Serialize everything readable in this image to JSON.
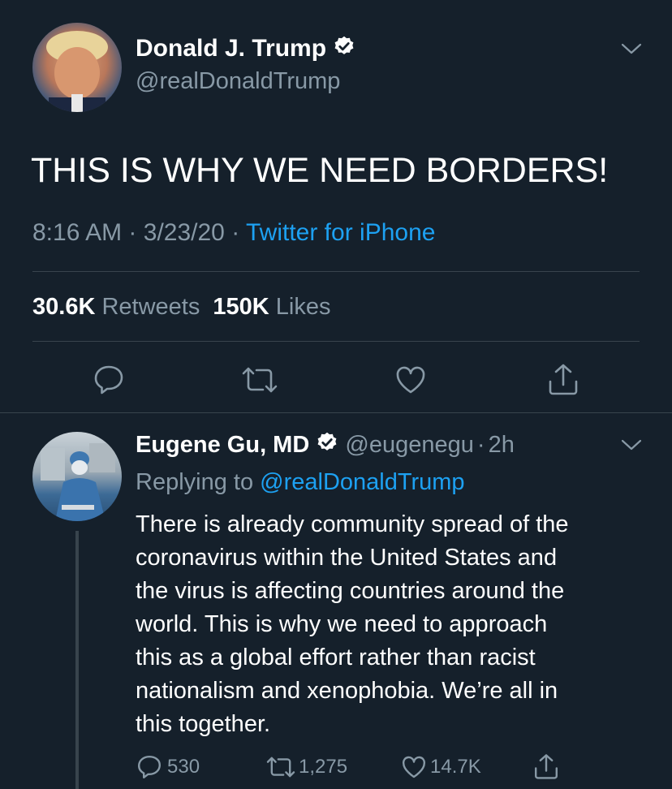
{
  "main_tweet": {
    "author_name": "Donald J. Trump",
    "handle": "@realDonaldTrump",
    "text": "THIS IS WHY WE NEED BORDERS!",
    "time": "8:16 AM",
    "separator": "·",
    "date": "3/23/20",
    "source": "Twitter for iPhone",
    "retweets_count": "30.6K",
    "retweets_label": "Retweets",
    "likes_count": "150K",
    "likes_label": "Likes"
  },
  "reply": {
    "author_name": "Eugene Gu, MD",
    "handle": "@eugenegu",
    "separator": "·",
    "age": "2h",
    "replying_prefix": "Replying to",
    "replying_to": "@realDonaldTrump",
    "text_lines": [
      "There is already community spread of the",
      "coronavirus within the United States and",
      "the virus is affecting countries around the",
      "world. This is why we need to approach",
      "this as a global effort rather than racist",
      "nationalism and xenophobia. We’re all in",
      "this together."
    ],
    "reply_count": "530",
    "retweet_count": "1,275",
    "like_count": "14.7K"
  },
  "colors": {
    "background": "#15202b",
    "muted": "#8899a6",
    "accent": "#1da1f2",
    "divider": "#38444d"
  },
  "icons": [
    "verified-icon",
    "chevron-down-icon",
    "reply-icon",
    "retweet-icon",
    "like-icon",
    "share-icon"
  ]
}
